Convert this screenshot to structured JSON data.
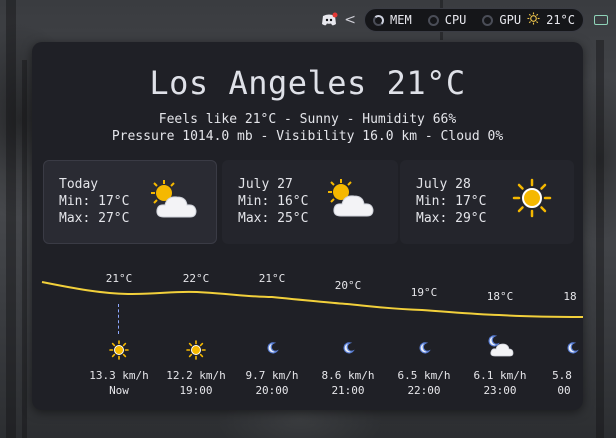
{
  "topbar": {
    "mem_label": "MEM",
    "cpu_label": "CPU",
    "gpu_label": "GPU",
    "weather_temp": "21°C",
    "chevron": "<",
    "icons": [
      "discord-icon",
      "sun-icon",
      "keyboard-icon"
    ]
  },
  "weather": {
    "title": "Los Angeles 21°C",
    "details_line1": "Feels like 21°C - Sunny - Humidity 66%",
    "details_line2": "Pressure 1014.0 mb - Visibility 16.0 km - Cloud 0%",
    "days": [
      {
        "label": "Today",
        "min": "Min: 17°C",
        "max": "Max: 27°C",
        "icon": "partly-cloudy-icon"
      },
      {
        "label": "July 27",
        "min": "Min: 16°C",
        "max": "Max: 25°C",
        "icon": "partly-cloudy-icon"
      },
      {
        "label": "July 28",
        "min": "Min: 17°C",
        "max": "Max: 29°C",
        "icon": "sun-icon"
      }
    ],
    "hourly": [
      {
        "temp": "21°C",
        "temp_value": 21,
        "icon": "sun-icon",
        "wind": "13.3 km/h",
        "time": "Now"
      },
      {
        "temp": "22°C",
        "temp_value": 22,
        "icon": "sun-icon",
        "wind": "12.2 km/h",
        "time": "19:00"
      },
      {
        "temp": "21°C",
        "temp_value": 21,
        "icon": "moon-icon",
        "wind": "9.7 km/h",
        "time": "20:00"
      },
      {
        "temp": "20°C",
        "temp_value": 20,
        "icon": "moon-icon",
        "wind": "8.6 km/h",
        "time": "21:00"
      },
      {
        "temp": "19°C",
        "temp_value": 19,
        "icon": "moon-icon",
        "wind": "6.5 km/h",
        "time": "22:00"
      },
      {
        "temp": "18°C",
        "temp_value": 18,
        "icon": "cloudy-night-icon",
        "wind": "6.1 km/h",
        "time": "23:00"
      },
      {
        "temp": "18",
        "temp_value": 18,
        "icon": "moon-icon",
        "wind": "5.8",
        "time": "00"
      }
    ],
    "colors": {
      "curve": "#f2d03b",
      "now_marker": "#8ea8ff",
      "sun": "#f5b800"
    }
  }
}
